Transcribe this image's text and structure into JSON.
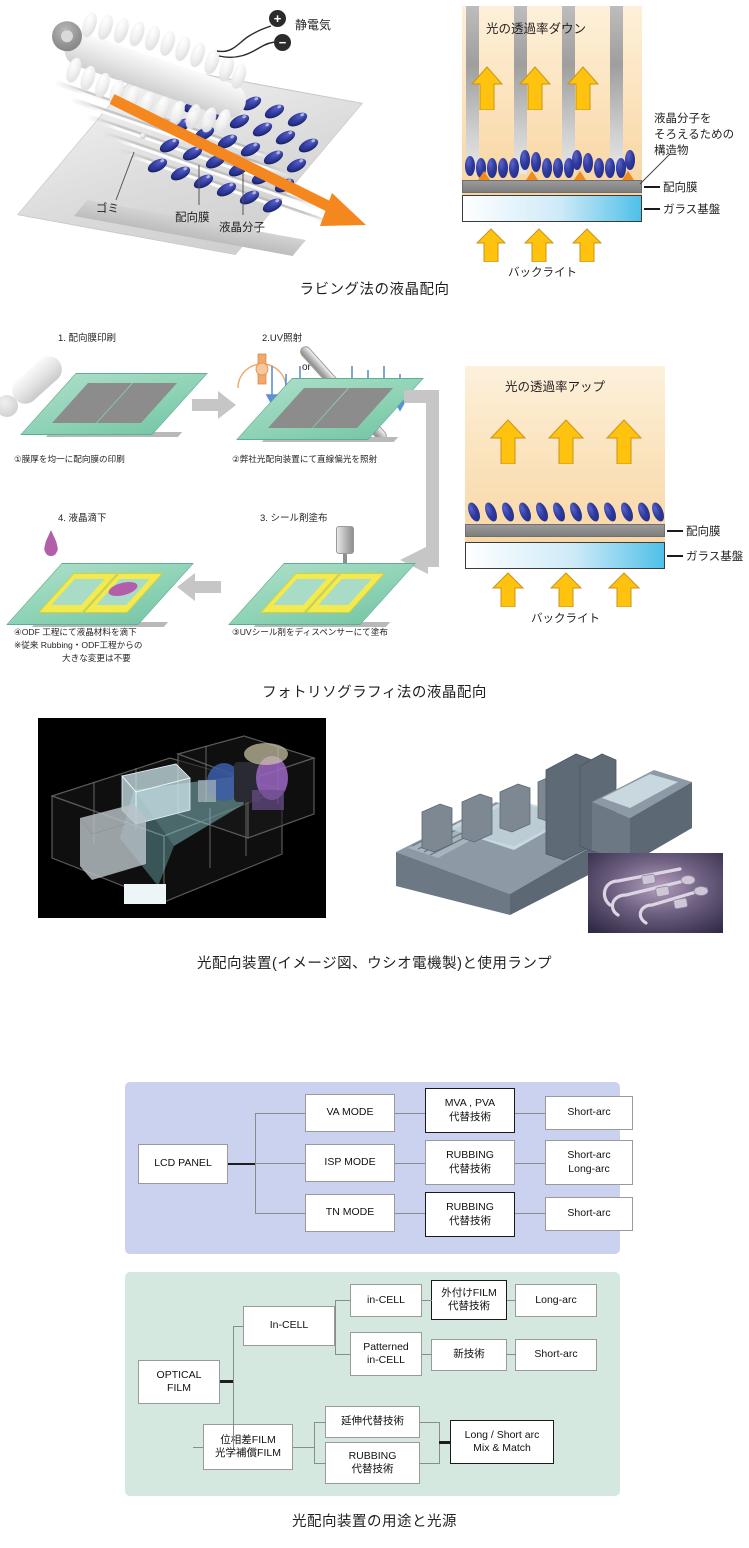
{
  "document": {
    "language": "ja",
    "topic": "LCD liquid crystal alignment — rubbing vs photo-alignment"
  },
  "section1": {
    "caption": "ラビング法の液晶配向",
    "left_illustration": {
      "name": "rubbing-roller-isometric",
      "static_label": "静電気",
      "plus_sign": "+",
      "minus_sign": "−",
      "labels": [
        {
          "text": "ゴミ"
        },
        {
          "text": "配向膜"
        },
        {
          "text": "液晶分子"
        }
      ],
      "arrow_color": "#F5871F"
    },
    "cross_section": {
      "title": "光の透過率ダウン",
      "backlight_label": "バックライト",
      "right_labels": [
        "液晶分子を",
        "そろえるための",
        "構造物"
      ],
      "layer_labels": [
        "配向膜",
        "ガラス基盤"
      ],
      "colors": {
        "backlight_glow": "#FBE3BD",
        "arrow": "#FFC20E",
        "lc_molecule": "#2F3A9E",
        "bump": "#F08A1D",
        "align_film": "#8A8A8A",
        "glass": "#4FC0E8"
      }
    }
  },
  "section2": {
    "caption": "フォトリソグラフィ法の液晶配向",
    "steps": [
      {
        "number": "1.",
        "title": "1. 配向膜印刷",
        "desc": "①膜厚を均一に配向膜の印刷"
      },
      {
        "number": "2.",
        "title": "2.UV照射",
        "desc": "②弊社光配向装置にて直線偏光を照射",
        "or_label": "or"
      },
      {
        "number": "3.",
        "title": "3. シール剤塗布",
        "desc": "③UVシール剤をディスペンサーにて塗布"
      },
      {
        "number": "4.",
        "title": "4. 液晶滴下",
        "desc_line1": "④ODF 工程にて液晶材料を滴下",
        "desc_line2": "※従来 Rubbing・ODF工程からの",
        "desc_line3": "大きな変更は不要"
      }
    ],
    "cross_section": {
      "title": "光の透過率アップ",
      "backlight_label": "バックライト",
      "layer_labels": [
        "配向膜",
        "ガラス基盤"
      ]
    }
  },
  "section3": {
    "caption": "光配向装置(イメージ図、ウシオ電機製)と使用ランプ",
    "photos": [
      {
        "name": "photo-alignment-equipment-concept"
      },
      {
        "name": "photo-alignment-stage-machine"
      },
      {
        "name": "uv-lamp-photo"
      }
    ]
  },
  "section4": {
    "caption": "光配向装置の用途と光源",
    "chart_lcd": {
      "panel_color": "#CBD2EF",
      "root": "LCD PANEL",
      "rows": [
        {
          "mode": "VA MODE",
          "tech": "MVA , PVA\n代替技術",
          "source": "Short-arc"
        },
        {
          "mode": "ISP MODE",
          "tech": "RUBBING\n代替技術",
          "source": "Short-arc\nLong-arc"
        },
        {
          "mode": "TN MODE",
          "tech": "RUBBING\n代替技術",
          "source": "Short-arc"
        }
      ]
    },
    "chart_optical": {
      "panel_color": "#D5E8E0",
      "root": "OPTICAL\nFILM",
      "branch_incell": {
        "label": "In-CELL",
        "children": [
          {
            "node": "in-CELL",
            "tech": "外付けFILM\n代替技術",
            "source": "Long-arc"
          },
          {
            "node": "Patterned\nin-CELL",
            "tech": "新技術",
            "source": "Short-arc"
          }
        ]
      },
      "branch_film": {
        "label": "位相差FILM\n光学補償FILM",
        "children": [
          {
            "node": "延伸代替技術"
          },
          {
            "node": "RUBBING\n代替技術"
          }
        ],
        "source": "Long / Short arc\nMix & Match"
      }
    }
  }
}
